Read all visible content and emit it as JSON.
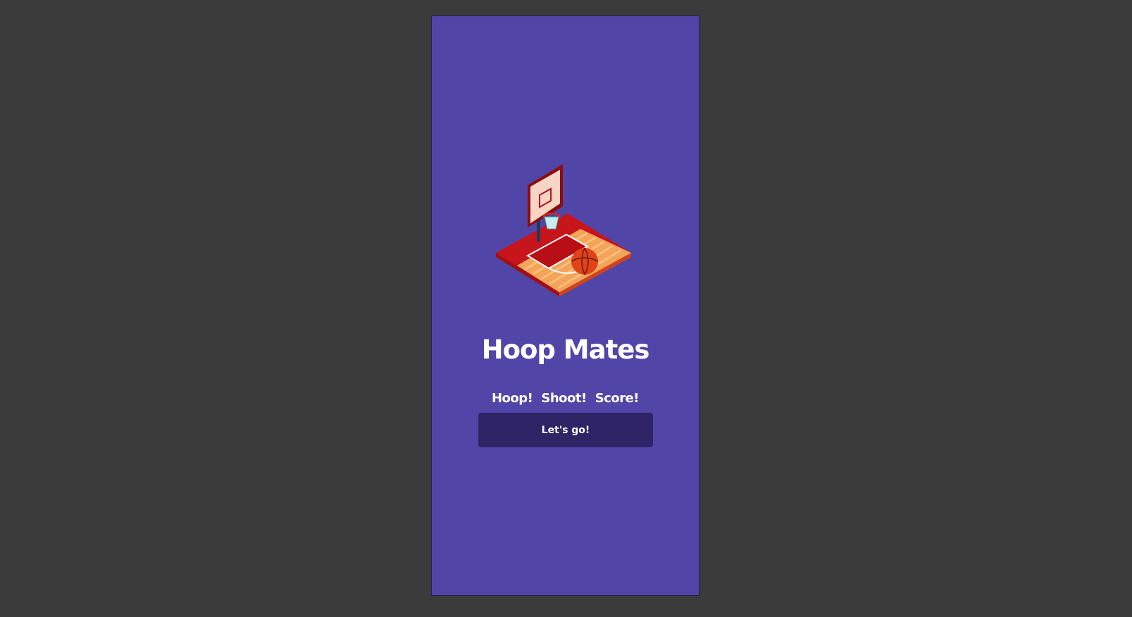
{
  "app": {
    "title": "Hoop Mates",
    "taglines": [
      "Hoop!",
      "Shoot!",
      "Score!"
    ],
    "cta_label": "Let's go!",
    "hero_image": "basketball-court-illustration"
  },
  "colors": {
    "window_background": "#3b3b3b",
    "screen_background": "#5145a8",
    "button_background": "#2f2466",
    "text": "#ffffff",
    "court_red": "#c8141b",
    "court_wood": "#f3a35a",
    "ball_orange": "#e0431a"
  }
}
